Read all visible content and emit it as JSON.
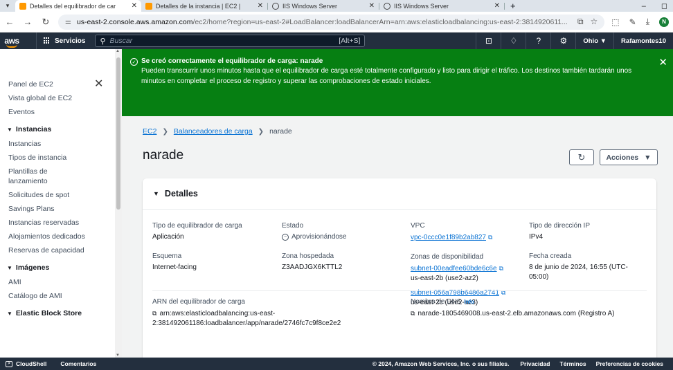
{
  "browser": {
    "tabs": [
      {
        "title": "Detalles del equilibrador de car",
        "active": true
      },
      {
        "title": "Detalles de la instancia | EC2 | ",
        "active": false
      },
      {
        "title": "IIS Windows Server",
        "active": false
      },
      {
        "title": "IIS Windows Server",
        "active": false
      }
    ],
    "url_host": "us-east-2.console.aws.amazon.com",
    "url_rest": "/ec2/home?region=us-east-2#LoadBalancer:loadBalancerArn=arn:aws:elasticloadbalancing:us-east-2:3814920611...",
    "profile_initial": "N"
  },
  "awsnav": {
    "logo": "aws",
    "services_label": "Servicios",
    "search_placeholder": "Buscar",
    "search_shortcut": "[Alt+S]",
    "region_label": "Ohio ▼",
    "account_label": "Rafamontes10"
  },
  "sidebar": {
    "top_items": [
      "Panel de EC2",
      "Vista global de EC2",
      "Eventos"
    ],
    "sections": [
      {
        "title": "Instancias",
        "items": [
          "Instancias",
          "Tipos de instancia",
          "Plantillas de lanzamiento",
          "Solicitudes de spot",
          "Savings Plans",
          "Instancias reservadas",
          "Alojamientos dedicados",
          "Reservas de capacidad"
        ]
      },
      {
        "title": "Imágenes",
        "items": [
          "AMI",
          "Catálogo de AMI"
        ]
      },
      {
        "title": "Elastic Block Store",
        "items": []
      }
    ]
  },
  "flash": {
    "title": "Se creó correctamente el equilibrador de carga: narade",
    "body": "Pueden transcurrir unos minutos hasta que el equilibrador de carga esté totalmente configurado y listo para dirigir el tráfico. Los destinos también tardarán unos minutos en completar el proceso de registro y superar las comprobaciones de estado iniciales.",
    "color": "#067f12"
  },
  "breadcrumb": {
    "ec2": "EC2",
    "balancers": "Balanceadores de carga",
    "current": "narade"
  },
  "page": {
    "title": "narade",
    "actions_label": "Acciones"
  },
  "details": {
    "heading": "Detalles",
    "type_label": "Tipo de equilibrador de carga",
    "type_value": "Aplicación",
    "scheme_label": "Esquema",
    "scheme_value": "Internet-facing",
    "state_label": "Estado",
    "state_value": "Aprovisionándose",
    "zone_label": "Zona hospedada",
    "zone_value": "Z3AADJGX6KTTL2",
    "vpc_label": "VPC",
    "vpc_value": "vpc-0ccc0e1f89b2ab827",
    "az_label": "Zonas de disponibilidad",
    "subnet1": "subnet-00eadfee60bde6c6e",
    "subnet1_zone": "us-east-2b (use2-az2)",
    "subnet2": "subnet-056a798b6486a2741",
    "subnet2_zone": "us-east-2c (use2-az3)",
    "ip_label": "Tipo de dirección IP",
    "ip_value": "IPv4",
    "created_label": "Fecha creada",
    "created_value": "8 de junio de 2024, 16:55 (UTC-05:00)",
    "arn_label": "ARN del equilibrador de carga",
    "arn_value": "arn:aws:elasticloadbalancing:us-east-2:381492061186:loadbalancer/app/narade/2746fc7c9f8ce2e2",
    "dns_label": "Nombre de DNS",
    "dns_info": "Info",
    "dns_value": "narade-1805469008.us-east-2.elb.amazonaws.com (Registro A)"
  },
  "footer": {
    "cloudshell": "CloudShell",
    "feedback": "Comentarios",
    "copyright": "© 2024, Amazon Web Services, Inc. o sus filiales.",
    "privacy": "Privacidad",
    "terms": "Términos",
    "cookies": "Preferencias de cookies"
  }
}
